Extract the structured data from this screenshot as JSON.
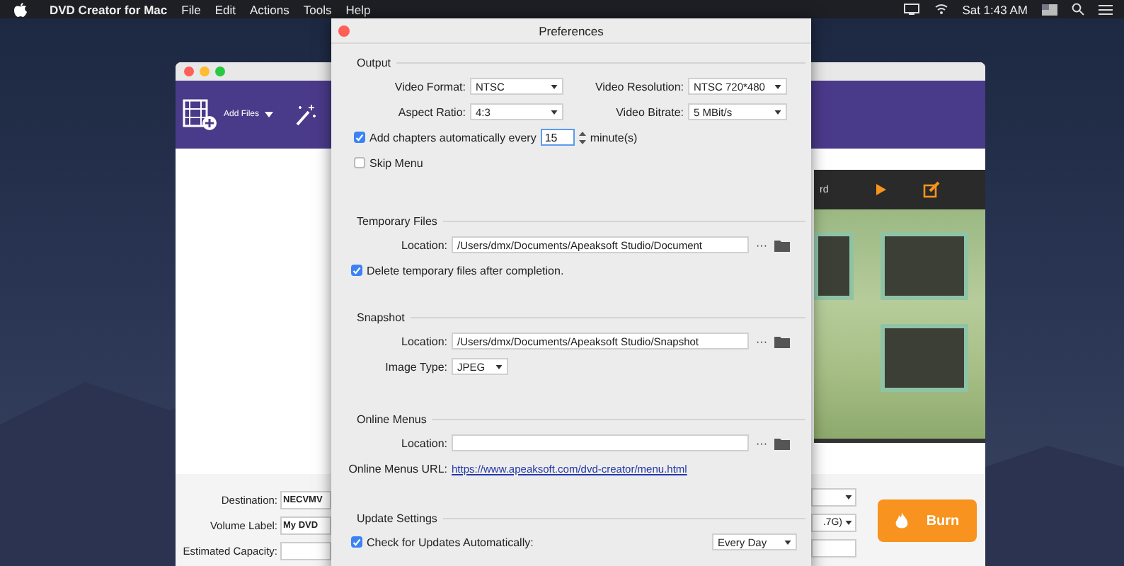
{
  "menubar": {
    "app_name": "DVD Creator for Mac",
    "items": [
      "File",
      "Edit",
      "Actions",
      "Tools",
      "Help"
    ],
    "clock": "Sat 1:43 AM"
  },
  "app_window": {
    "toolbar": [
      {
        "label": "Add Files"
      }
    ],
    "preview_header": "rd",
    "fields": [
      {
        "label": "Destination:",
        "value": "NECVMV"
      },
      {
        "label": "Volume Label:",
        "value": "My DVD"
      },
      {
        "label": "Estimated Capacity:"
      }
    ],
    "right_fields": [
      {
        "kind": "select"
      },
      {
        "kind": "select",
        "value": ".7G)"
      },
      {
        "kind": "input"
      }
    ],
    "burn_button": "Burn"
  },
  "preferences": {
    "title": "Preferences",
    "sections": [
      {
        "title": "Output",
        "rows": [
          {
            "kind": "pair",
            "fields": [
              {
                "label": "Video Format:",
                "value": "NTSC"
              },
              {
                "label": "Video Resolution:",
                "value": "NTSC 720*480"
              }
            ]
          },
          {
            "kind": "pair",
            "fields": [
              {
                "label": "Aspect Ratio:",
                "value": "4:3"
              },
              {
                "label": "Video Bitrate:",
                "value": "5 MBit/s"
              }
            ]
          },
          {
            "kind": "chapters",
            "checked": true,
            "label": "Add chapters automatically every",
            "value": "15",
            "unit": "minute(s)"
          },
          {
            "kind": "checkbox",
            "checked": false,
            "label": "Skip Menu"
          }
        ]
      },
      {
        "title": "Temporary Files",
        "rows": [
          {
            "kind": "path",
            "label": "Location:",
            "value": "/Users/dmx/Documents/Apeaksoft Studio/Document",
            "more": "···"
          },
          {
            "kind": "checkbox",
            "checked": true,
            "label": "Delete temporary files after completion."
          }
        ]
      },
      {
        "title": "Snapshot",
        "rows": [
          {
            "kind": "path",
            "label": "Location:",
            "value": "/Users/dmx/Documents/Apeaksoft Studio/Snapshot",
            "more": "···"
          },
          {
            "kind": "select",
            "label": "Image Type:",
            "value": "JPEG"
          }
        ]
      },
      {
        "title": "Online Menus",
        "rows": [
          {
            "kind": "path",
            "label": "Location:",
            "more": "···"
          },
          {
            "kind": "link",
            "label": "Online Menus URL:",
            "value": "https://www.apeaksoft.com/dvd-creator/menu.html"
          }
        ]
      },
      {
        "title": "Update Settings",
        "rows": [
          {
            "kind": "checkselect",
            "checked": true,
            "label": "Check for Updates Automatically:",
            "value": "Every Day"
          }
        ]
      }
    ]
  }
}
